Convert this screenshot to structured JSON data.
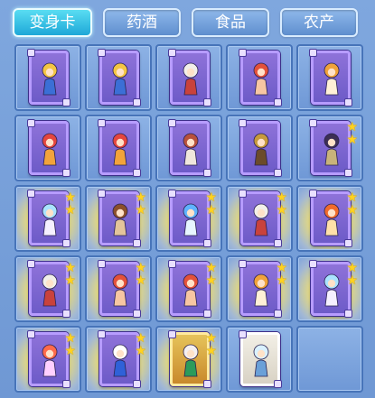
{
  "tabs": [
    {
      "label": "变身卡",
      "active": true
    },
    {
      "label": "药酒",
      "active": false
    },
    {
      "label": "食品",
      "active": false
    },
    {
      "label": "农产",
      "active": false
    }
  ],
  "colors": {
    "accent": "#1ea8d8",
    "star": "#ffd21f",
    "card_purple": "#7b63cf",
    "card_gold": "#d9a73f",
    "card_silver": "#e9e4d8"
  },
  "inventory": {
    "slots": [
      {
        "item": "transform-card",
        "figure": "yellow-mascot",
        "frame": "purple",
        "stars": 0,
        "glow": false
      },
      {
        "item": "transform-card",
        "figure": "yellow-mascot",
        "frame": "purple",
        "stars": 0,
        "glow": false
      },
      {
        "item": "transform-card",
        "figure": "white-haired-warrior",
        "frame": "purple",
        "stars": 0,
        "glow": false
      },
      {
        "item": "transform-card",
        "figure": "red-haired-girl",
        "frame": "purple",
        "stars": 0,
        "glow": false
      },
      {
        "item": "transform-card",
        "figure": "fox-girl",
        "frame": "purple",
        "stars": 0,
        "glow": false
      },
      {
        "item": "transform-card",
        "figure": "red-phoenix",
        "frame": "purple",
        "stars": 0,
        "glow": false
      },
      {
        "item": "transform-card",
        "figure": "red-phoenix",
        "frame": "purple",
        "stars": 0,
        "glow": false
      },
      {
        "item": "transform-card",
        "figure": "winged-beast",
        "frame": "purple",
        "stars": 0,
        "glow": false
      },
      {
        "item": "transform-card",
        "figure": "armored-general",
        "frame": "purple",
        "stars": 0,
        "glow": false
      },
      {
        "item": "transform-card",
        "figure": "dark-knight",
        "frame": "purple",
        "stars": 2,
        "glow": false
      },
      {
        "item": "transform-card",
        "figure": "crystal-fairy",
        "frame": "purple",
        "stars": 2,
        "glow": true
      },
      {
        "item": "transform-card",
        "figure": "cowboy",
        "frame": "purple",
        "stars": 2,
        "glow": true
      },
      {
        "item": "transform-card",
        "figure": "ice-wolf",
        "frame": "purple",
        "stars": 2,
        "glow": true
      },
      {
        "item": "transform-card",
        "figure": "white-haired-warrior",
        "frame": "purple",
        "stars": 2,
        "glow": true
      },
      {
        "item": "transform-card",
        "figure": "fire-dancer",
        "frame": "purple",
        "stars": 2,
        "glow": true
      },
      {
        "item": "transform-card",
        "figure": "white-haired-warrior",
        "frame": "purple",
        "stars": 2,
        "glow": true
      },
      {
        "item": "transform-card",
        "figure": "red-haired-girl",
        "frame": "purple",
        "stars": 2,
        "glow": true
      },
      {
        "item": "transform-card",
        "figure": "red-haired-girl",
        "frame": "purple",
        "stars": 2,
        "glow": true
      },
      {
        "item": "transform-card",
        "figure": "fox-girl",
        "frame": "purple",
        "stars": 2,
        "glow": true
      },
      {
        "item": "transform-card",
        "figure": "crystal-fairy",
        "frame": "purple",
        "stars": 2,
        "glow": true
      },
      {
        "item": "transform-card",
        "figure": "phoenix-fairy",
        "frame": "purple",
        "stars": 2,
        "glow": true
      },
      {
        "item": "transform-card",
        "figure": "snowman-clown",
        "frame": "purple",
        "stars": 2,
        "glow": true
      },
      {
        "item": "transform-card",
        "figure": "heroine",
        "frame": "gold",
        "stars": 2,
        "glow": true
      },
      {
        "item": "transform-card",
        "figure": "ice-dragon",
        "frame": "silver",
        "stars": 0,
        "glow": false
      },
      {
        "item": "empty",
        "figure": "",
        "frame": "",
        "stars": 0,
        "glow": false
      }
    ]
  }
}
